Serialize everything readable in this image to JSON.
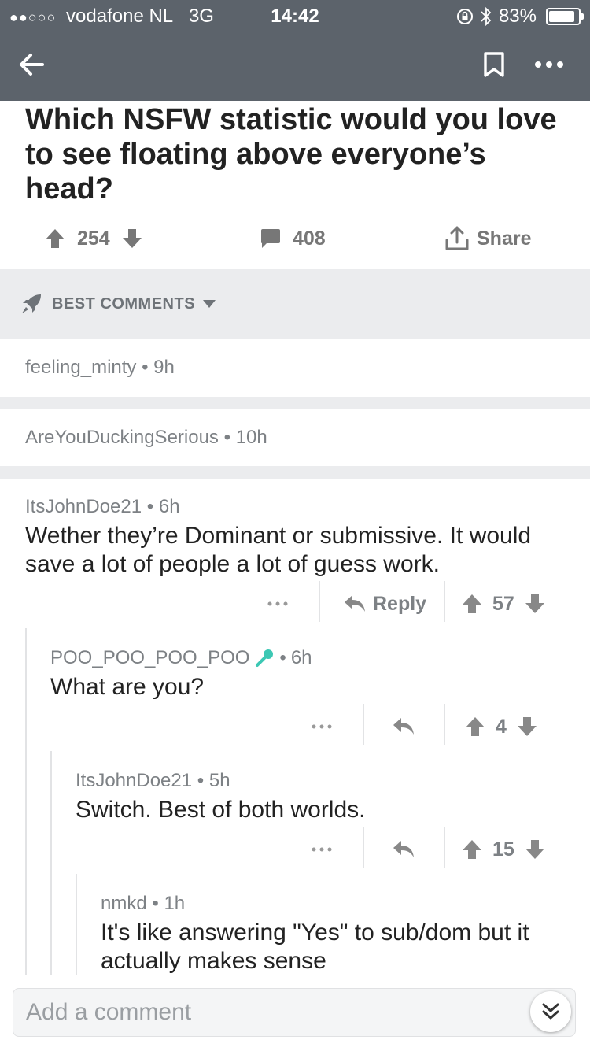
{
  "status_bar": {
    "carrier": "vodafone NL",
    "network": "3G",
    "time": "14:42",
    "battery": "83%",
    "signal_icon": "signal-dots-icon",
    "lock_icon": "rotation-lock-icon",
    "bluetooth_icon": "bluetooth-icon",
    "battery_icon": "battery-icon"
  },
  "nav": {
    "back_icon": "arrow-left-icon",
    "bookmark_icon": "bookmark-icon",
    "more_icon": "more-horizontal-icon"
  },
  "post": {
    "title": "Which NSFW statistic would you love to see floating above everyone’s head?",
    "score": "254",
    "comment_count": "408",
    "share_label": "Share"
  },
  "sort": {
    "label": "BEST COMMENTS",
    "icon": "rocket-icon"
  },
  "collapsed_comments": [
    {
      "author": "feeling_minty",
      "age": "9h"
    },
    {
      "author": "AreYouDuckingSerious",
      "age": "10h"
    }
  ],
  "comments": [
    {
      "author": "ItsJohnDoe21",
      "age": "6h",
      "body": "Wether they’re Dominant or submissive. It would save a lot of people a lot of guess work.",
      "reply_label": "Reply",
      "score": "57"
    },
    {
      "author": "POO_POO_POO_POO",
      "flair_icon": "microphone-icon",
      "age": "6h",
      "body": "What are you?",
      "score": "4"
    },
    {
      "author": "ItsJohnDoe21",
      "age": "5h",
      "body": "Switch. Best of both worlds.",
      "score": "15"
    },
    {
      "author": "nmkd",
      "age": "1h",
      "body": "It's like answering \"Yes\" to sub/dom but it actually makes sense"
    }
  ],
  "footer": {
    "input_placeholder": "Add a comment",
    "collapse_icon": "double-chevron-down-icon"
  },
  "colors": {
    "header_bg": "#5c636b",
    "divider_bg": "#ebecee",
    "muted_text": "#7d8185",
    "flair": "#3cc8b4"
  }
}
